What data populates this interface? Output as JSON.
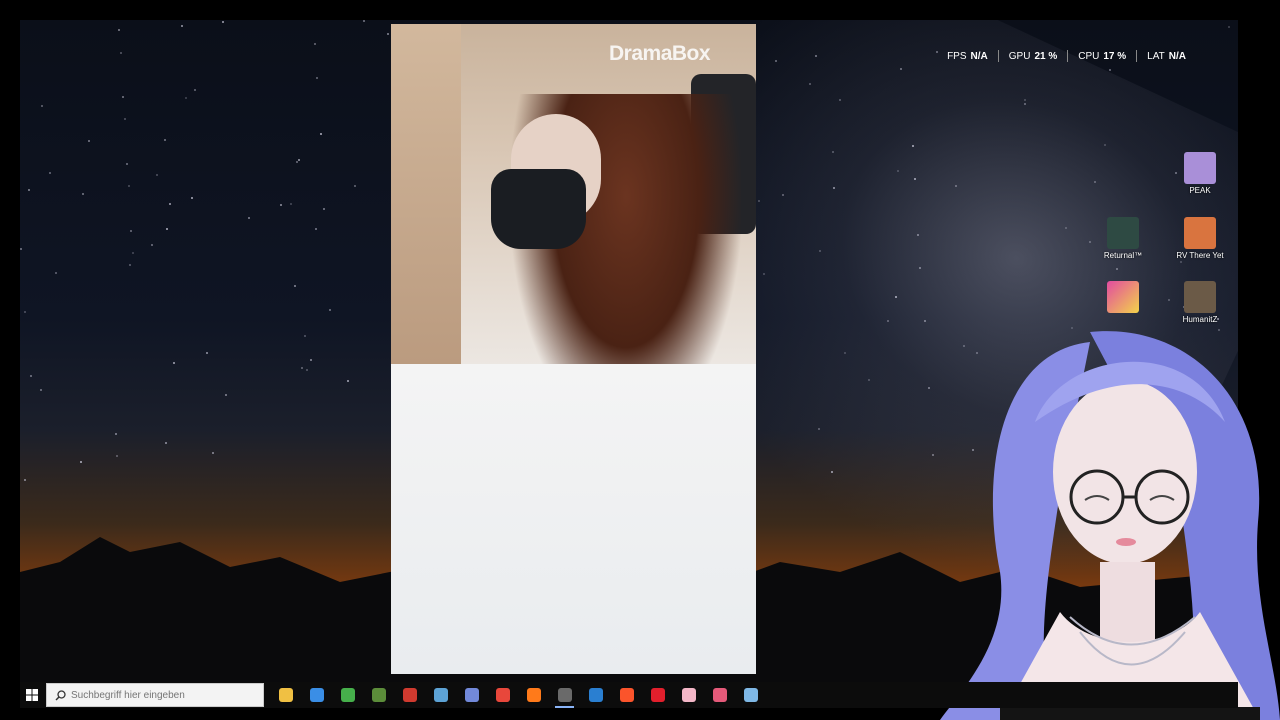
{
  "overlay": {
    "stats": [
      {
        "label": "FPS",
        "value": "N/A"
      },
      {
        "label": "GPU",
        "value": "21 %"
      },
      {
        "label": "CPU",
        "value": "17 %"
      },
      {
        "label": "LAT",
        "value": "N/A"
      }
    ]
  },
  "video": {
    "watermark": "DramaBox"
  },
  "desktop": {
    "icons": [
      {
        "name": "PEAK",
        "color": "#a98fd8"
      },
      {
        "name": "Returnal™",
        "color": "#2e4a43"
      },
      {
        "name": "RV There Yet",
        "color": "#d9743f"
      },
      {
        "name": "HumanitZ",
        "color": "#6b5a47"
      }
    ]
  },
  "taskbar": {
    "search_placeholder": "Suchbegriff hier eingeben",
    "apps": [
      {
        "icon": "file-explorer-icon",
        "color": "#f0c043"
      },
      {
        "icon": "calculator-icon",
        "color": "#3a8ee6"
      },
      {
        "icon": "android-studio-icon",
        "color": "#46b04b"
      },
      {
        "icon": "minecraft-icon",
        "color": "#5c8d3a"
      },
      {
        "icon": "news-app-icon",
        "color": "#d03a2f"
      },
      {
        "icon": "steam-icon",
        "color": "#5da3d6"
      },
      {
        "icon": "discord-icon",
        "color": "#7289da"
      },
      {
        "icon": "chrome-icon",
        "color": "#e8473b"
      },
      {
        "icon": "firefox-icon",
        "color": "#ff7a1a"
      },
      {
        "icon": "obs-icon",
        "color": "#6a6a6a"
      },
      {
        "icon": "steam-link-icon",
        "color": "#2a7fd1"
      },
      {
        "icon": "brave-icon",
        "color": "#fb542b"
      },
      {
        "icon": "opera-icon",
        "color": "#e21f2c"
      },
      {
        "icon": "pink-app-icon",
        "color": "#f4b7c8"
      },
      {
        "icon": "tool-app-icon",
        "color": "#e55a7a"
      },
      {
        "icon": "steam-alt-icon",
        "color": "#7fb8e6"
      }
    ],
    "active_app_index": 9
  }
}
